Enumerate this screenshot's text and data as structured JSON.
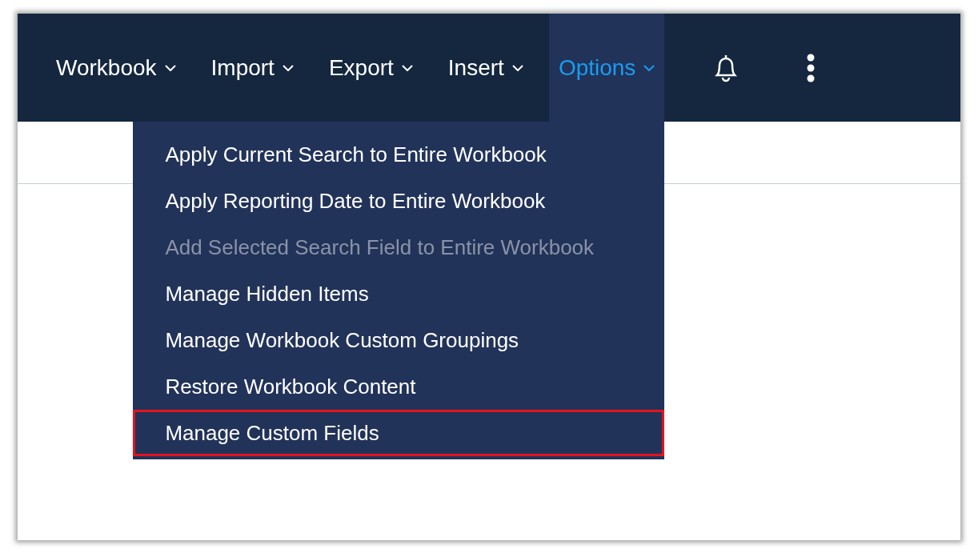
{
  "nav": {
    "items": [
      {
        "label": "Workbook",
        "selected": false
      },
      {
        "label": "Import",
        "selected": false
      },
      {
        "label": "Export",
        "selected": false
      },
      {
        "label": "Insert",
        "selected": false
      },
      {
        "label": "Options",
        "selected": true
      }
    ]
  },
  "options_menu": {
    "items": [
      {
        "label": "Apply Current Search to Entire Workbook",
        "disabled": false,
        "highlighted": false
      },
      {
        "label": "Apply Reporting Date to Entire Workbook",
        "disabled": false,
        "highlighted": false
      },
      {
        "label": "Add Selected Search Field to Entire Workbook",
        "disabled": true,
        "highlighted": false
      },
      {
        "label": "Manage Hidden Items",
        "disabled": false,
        "highlighted": false
      },
      {
        "label": "Manage Workbook Custom Groupings",
        "disabled": false,
        "highlighted": false
      },
      {
        "label": "Restore Workbook Content",
        "disabled": false,
        "highlighted": false
      },
      {
        "label": "Manage Custom Fields",
        "disabled": false,
        "highlighted": true
      }
    ]
  }
}
